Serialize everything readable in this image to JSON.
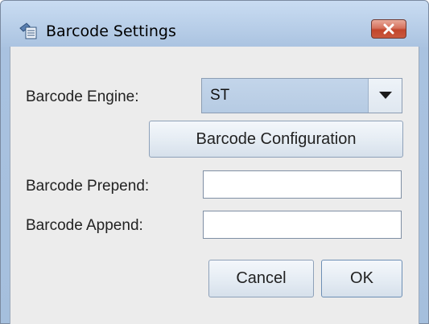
{
  "window": {
    "title": "Barcode Settings",
    "icons": {
      "app": "barcode-settings-app-icon",
      "close": "close-icon"
    }
  },
  "form": {
    "engine_label": "Barcode Engine:",
    "engine_value": "ST",
    "engine_icon": "chevron-down-icon",
    "config_button": "Barcode Configuration",
    "prepend_label": "Barcode Prepend:",
    "prepend_value": "",
    "append_label": "Barcode Append:",
    "append_value": ""
  },
  "actions": {
    "cancel": "Cancel",
    "ok": "OK"
  },
  "colors": {
    "title_gradient_top": "#c9dcf2",
    "client_bg": "#ececec",
    "close_button": "#c9583e"
  }
}
